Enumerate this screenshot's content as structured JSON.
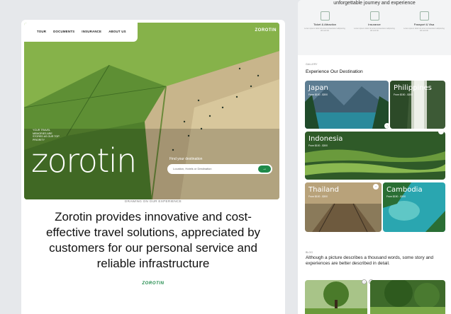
{
  "left": {
    "nav": {
      "links": [
        "TOUR",
        "DOCUMENTS",
        "INSURANCE",
        "ABOUT US"
      ],
      "logo": "ZOROTIN"
    },
    "hero": {
      "tagline": "YOUR TRAVEL MEMORIES ARE STORED AS OUR TOP PRIORITY",
      "title": "zorotin",
      "find_label": "Find your destination",
      "search_placeholder": "Location, Hotels or Destination",
      "search_icon": "arrow-right-icon"
    },
    "caption": "DRAWING ON OUR EXPERIENCE",
    "statement": "Zorotin provides innovative and cost-effective travel solutions, appreciated by customers for our personal service and reliable infrastructure",
    "brand_link": "ZOROTIN"
  },
  "right": {
    "tagline": "unforgettable journey and experience",
    "features": [
      {
        "title": "Ticket & Attraction",
        "desc": "Lorem ipsum dolor sit amet consectetur adipiscing elit sed do",
        "icon": "ticket-icon"
      },
      {
        "title": "Insurance",
        "desc": "Lorem ipsum dolor sit amet consectetur adipiscing elit sed do",
        "icon": "shield-icon"
      },
      {
        "title": "Passport & Visa",
        "desc": "Lorem ipsum dolor sit amet consectetur adipiscing elit sed do",
        "icon": "passport-icon"
      }
    ],
    "gallery_label": "GALLERY",
    "gallery_title": "Experience Our Destination",
    "destinations": [
      {
        "name": "Japan",
        "price": "From $100 - $300"
      },
      {
        "name": "Philippines",
        "price": "From $150 - $300"
      },
      {
        "name": "Indonesia",
        "price": "From $100 - $300"
      },
      {
        "name": "Thailand",
        "price": "From $100 - $300"
      },
      {
        "name": "Cambodia",
        "price": "From $150 - $300"
      }
    ],
    "blog_label": "BLOG",
    "blog_text": "Although a picture describes a thousand words, some story and experiences are better described in detail."
  },
  "colors": {
    "accent": "#1e8a4a",
    "page_bg": "#e6e8eb"
  }
}
